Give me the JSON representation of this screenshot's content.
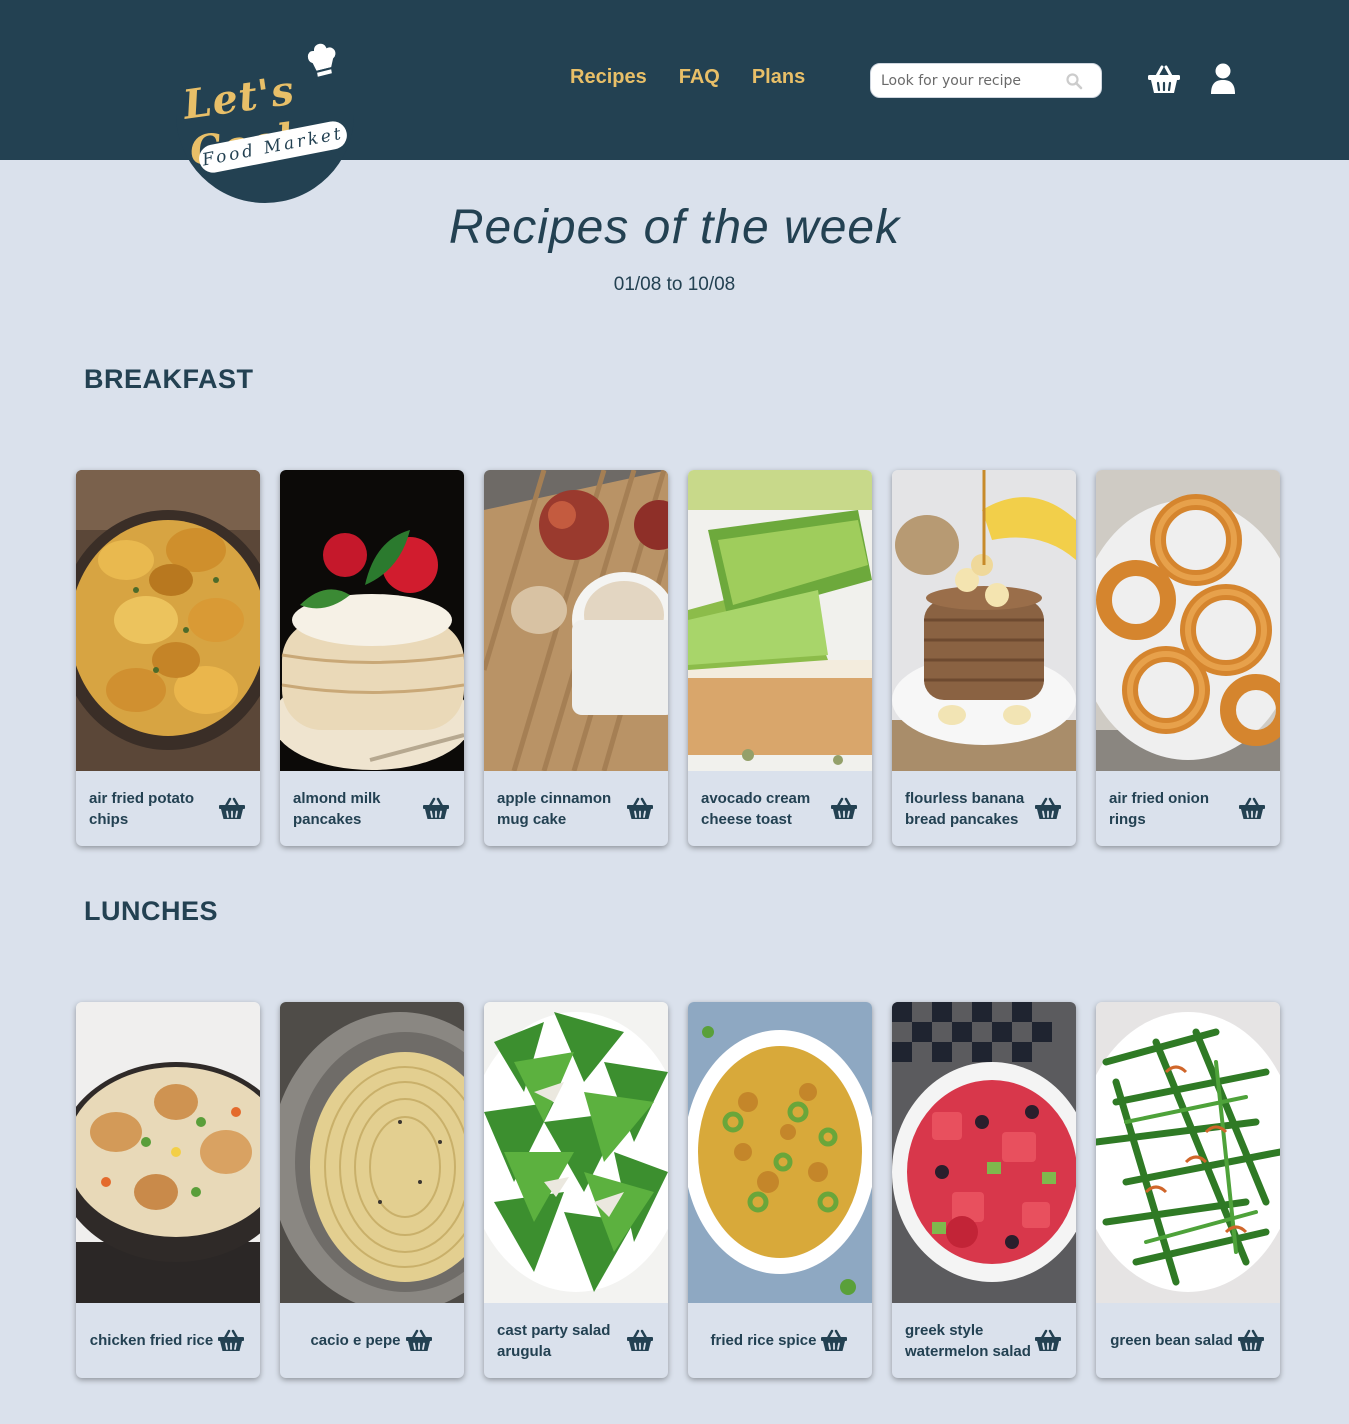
{
  "logo": {
    "script": "Let's Cook",
    "ribbon": "Food Market"
  },
  "nav": {
    "recipes": "Recipes",
    "faq": "FAQ",
    "plans": "Plans"
  },
  "search": {
    "placeholder": "Look for your recipe",
    "icon": "search-icon"
  },
  "header_icons": [
    "basket-icon",
    "user-icon"
  ],
  "heading": {
    "title": "Recipes of the week",
    "dates": "01/08 to 10/08"
  },
  "colors": {
    "header": "#234152",
    "accent": "#e8bf68",
    "background": "#dae1ec"
  },
  "sections": {
    "breakfast": {
      "title": "BREAKFAST",
      "items": [
        {
          "name": "air fried potato chips"
        },
        {
          "name": "almond milk pancakes"
        },
        {
          "name": "apple cinnamon mug cake"
        },
        {
          "name": "avocado cream cheese toast"
        },
        {
          "name": "flourless banana bread pancakes"
        },
        {
          "name": "air fried onion rings"
        }
      ]
    },
    "lunches": {
      "title": "LUNCHES",
      "items": [
        {
          "name": "chicken fried rice"
        },
        {
          "name": "cacio e pepe"
        },
        {
          "name": "cast party salad arugula"
        },
        {
          "name": "fried rice spice"
        },
        {
          "name": "greek style watermelon salad"
        },
        {
          "name": "green bean salad"
        }
      ]
    }
  }
}
